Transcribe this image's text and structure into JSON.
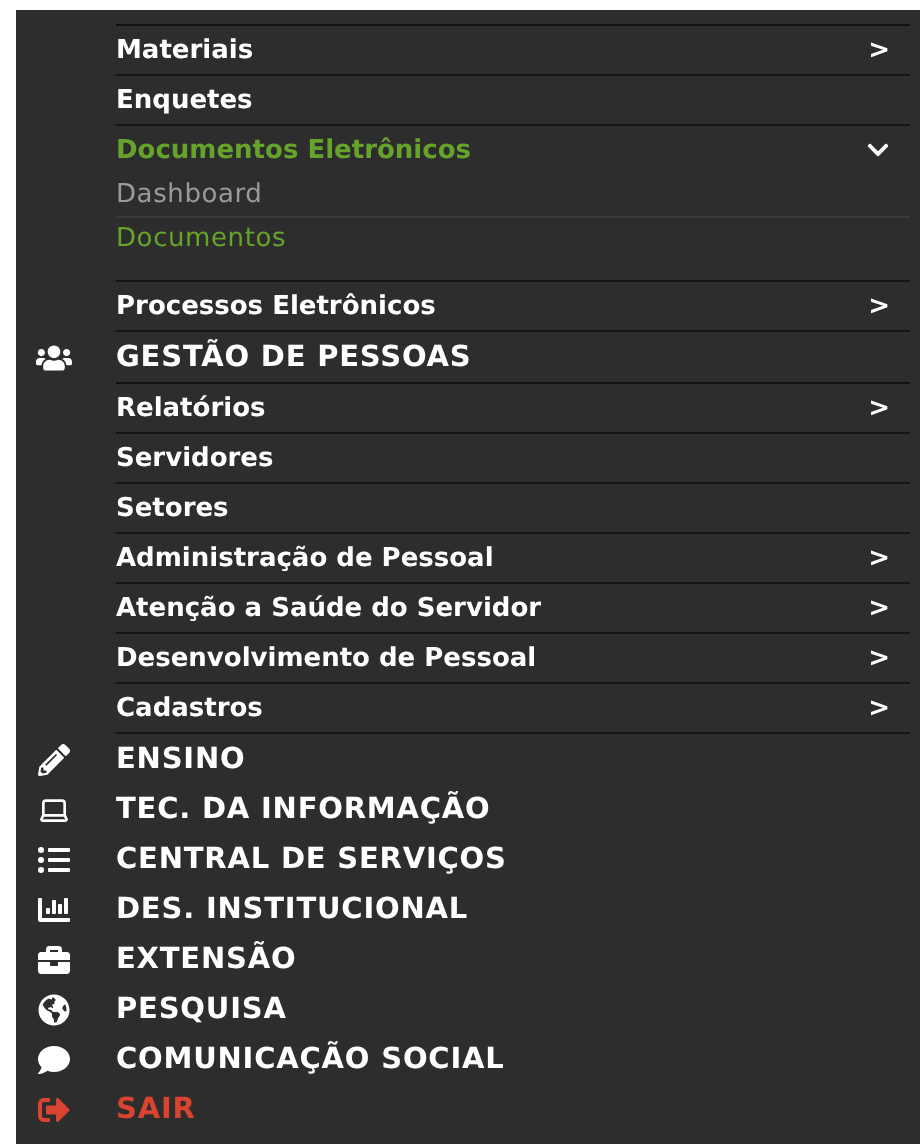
{
  "top_items": [
    {
      "label": "Materiais",
      "indicator": ">",
      "selected": false
    },
    {
      "label": "Enquetes",
      "selected": false
    },
    {
      "label": "Documentos Eletrônicos",
      "selected": true,
      "expanded": true,
      "children": [
        {
          "label": "Dashboard",
          "selected": false
        },
        {
          "label": "Documentos",
          "selected": true
        }
      ]
    },
    {
      "label": "Processos Eletrônicos",
      "indicator": ">",
      "selected": false
    }
  ],
  "sections": [
    {
      "label": "GESTÃO DE PESSOAS",
      "kind": "normal",
      "items": [
        {
          "label": "Relatórios",
          "indicator": ">",
          "selected": false
        },
        {
          "label": "Servidores",
          "selected": false
        },
        {
          "label": "Setores",
          "selected": false
        },
        {
          "label": "Administração de Pessoal",
          "indicator": ">",
          "selected": false
        },
        {
          "label": "Atenção a Saúde do Servidor",
          "indicator": ">",
          "selected": false
        },
        {
          "label": "Desenvolvimento de Pessoal",
          "indicator": ">",
          "selected": false
        },
        {
          "label": "Cadastros",
          "indicator": ">",
          "selected": false
        }
      ]
    },
    {
      "label": "ENSINO",
      "kind": "normal"
    },
    {
      "label": "TEC. DA INFORMAÇÃO",
      "kind": "normal"
    },
    {
      "label": "CENTRAL DE SERVIÇOS",
      "kind": "normal"
    },
    {
      "label": "DES. INSTITUCIONAL",
      "kind": "normal"
    },
    {
      "label": "EXTENSÃO",
      "kind": "normal"
    },
    {
      "label": "PESQUISA",
      "kind": "normal"
    },
    {
      "label": "COMUNICAÇÃO SOCIAL",
      "kind": "normal"
    },
    {
      "label": "SAIR",
      "kind": "logout"
    }
  ]
}
